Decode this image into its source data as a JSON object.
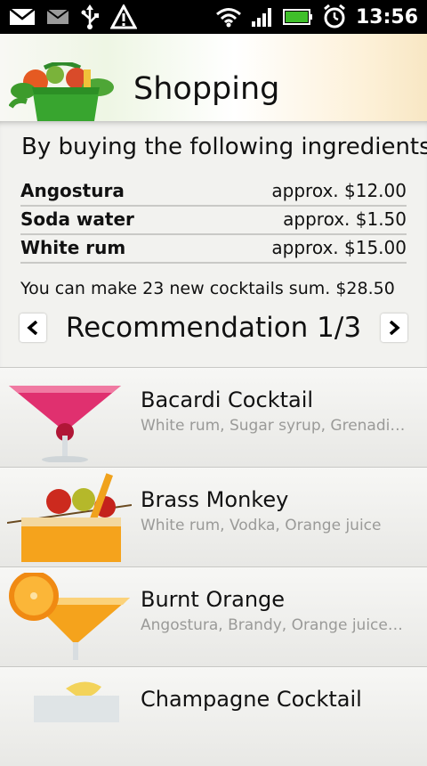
{
  "status_bar": {
    "time": "13:56",
    "icons_left": [
      "mail-icon",
      "mail-gray-icon",
      "usb-icon",
      "warning-icon"
    ],
    "icons_right": [
      "wifi-icon",
      "signal-icon",
      "battery-icon",
      "alarm-icon"
    ]
  },
  "header": {
    "title": "Shopping",
    "logo_icon": "grocery-bag-icon"
  },
  "summary": {
    "heading": "By buying the following ingredients:",
    "ingredients": [
      {
        "name": "Angostura",
        "price": "approx. $12.00"
      },
      {
        "name": "Soda water",
        "price": "approx. $1.50"
      },
      {
        "name": "White rum",
        "price": "approx. $15.00"
      }
    ],
    "total_text": "You can make 23 new cocktails sum. $28.50",
    "recommendation_label": "Recommendation 1/3"
  },
  "cocktails": [
    {
      "name": "Bacardi Cocktail",
      "ingredients": "White rum, Sugar syrup, Grenadin...",
      "thumb": "pink-martini-icon"
    },
    {
      "name": "Brass Monkey",
      "ingredients": "White rum, Vodka, Orange juice",
      "thumb": "orange-highball-icon"
    },
    {
      "name": "Burnt Orange",
      "ingredients": "Angostura, Brandy, Orange juice, I...",
      "thumb": "orange-martini-icon"
    },
    {
      "name": "Champagne Cocktail",
      "ingredients": "",
      "thumb": "champagne-icon"
    }
  ],
  "colors": {
    "status_bar": "#000000",
    "battery": "#3fbf2a",
    "bacardi_drink": "#e0306f",
    "orange_drink": "#f5a31c"
  }
}
